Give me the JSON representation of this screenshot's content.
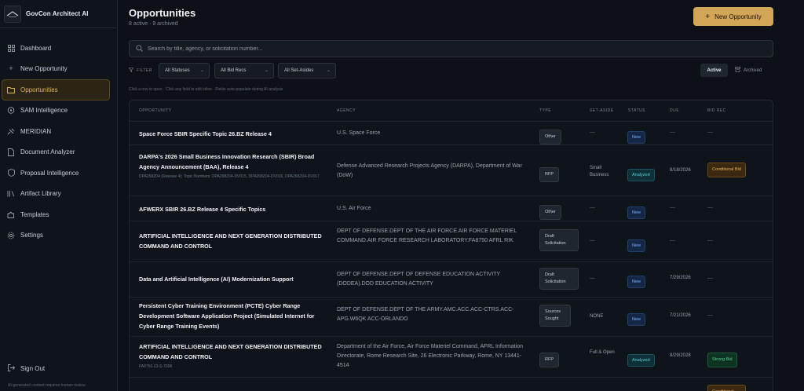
{
  "app": {
    "title": "GovCon Architect AI"
  },
  "sidebar": {
    "items": [
      {
        "label": "Dashboard",
        "icon": "grid-icon"
      },
      {
        "label": "New Opportunity",
        "icon": "plus-icon"
      },
      {
        "label": "Opportunities",
        "icon": "folder-icon",
        "active": true
      },
      {
        "label": "SAM Intelligence",
        "icon": "radar-icon"
      },
      {
        "label": "MERIDIAN",
        "icon": "satellite-icon"
      },
      {
        "label": "Document Analyzer",
        "icon": "document-icon"
      },
      {
        "label": "Proposal Intelligence",
        "icon": "shield-icon"
      },
      {
        "label": "Artifact Library",
        "icon": "library-icon"
      },
      {
        "label": "Templates",
        "icon": "puzzle-icon"
      },
      {
        "label": "Settings",
        "icon": "gear-icon"
      }
    ],
    "signout": "Sign Out",
    "disclaimer": "AI-generated content requires human review"
  },
  "header": {
    "title": "Opportunities",
    "subtitle": "8 active · 9 archived",
    "new_button": "New Opportunity"
  },
  "search": {
    "placeholder": "Search by title, agency, or solicitation number..."
  },
  "filters": {
    "label": "FILTER",
    "statuses": "All Statuses",
    "bid_recs": "All Bid Recs",
    "set_asides": "All Set-Asides",
    "active_toggle": "Active",
    "archived_toggle": "Archived"
  },
  "hint": "Click a row to open · Click any field to edit inline · Fields auto-populate during AI analysis",
  "table": {
    "headers": {
      "opportunity": "OPPORTUNITY",
      "agency": "AGENCY",
      "type": "TYPE",
      "set_aside": "SET-ASIDE",
      "status": "STATUS",
      "due": "DUE",
      "bid_rec": "BID REC"
    },
    "rows": [
      {
        "title": "Space Force SBIR Specific Topic 26.BZ Release 4",
        "sub": "",
        "agency": "U.S. Space Force",
        "type": "Other",
        "set_aside": "—",
        "status": "New",
        "due": "—",
        "bid_rec": "—"
      },
      {
        "title": "DARPA's 2026 Small Business Innovation Research (SBIR) Broad Agency Announcement (BAA), Release 4",
        "sub": "DPA268Z04 (Release 4); Topic Numbers: DPA268Z04-DV015, DPA268Z04-DV016, DPA268Z04-DV017",
        "agency": "Defense Advanced Research Projects Agency (DARPA), Department of War (DoW)",
        "type": "RFP",
        "set_aside": "Small Business",
        "status": "Analyzed",
        "due": "8/18/2026",
        "bid_rec": "Conditional Bid"
      },
      {
        "title": "AFWERX SBIR 26.BZ Release 4 Specific Topics",
        "sub": "",
        "agency": "U.S. Air Force",
        "type": "Other",
        "set_aside": "—",
        "status": "New",
        "due": "—",
        "bid_rec": "—"
      },
      {
        "title": "ARTIFICIAL INTELLIGENCE AND NEXT GENERATION DISTRIBUTED COMMAND AND CONTROL",
        "sub": "",
        "agency": "DEPT OF DEFENSE.DEPT OF THE AIR FORCE.AIR FORCE MATERIEL COMMAND.AIR FORCE RESEARCH LABORATORY.FA8750 AFRL RIK",
        "type": "Draft Solicitation",
        "set_aside": "—",
        "status": "New",
        "due": "—",
        "bid_rec": "—"
      },
      {
        "title": "Data and Artificial Intelligence (AI) Modernization Support",
        "sub": "",
        "agency": "DEPT OF DEFENSE.DEPT OF DEFENSE EDUCATION ACTIVITY (DODEA).DOD EDUCATION ACTIVITY",
        "type": "Draft Solicitation",
        "set_aside": "—",
        "status": "New",
        "due": "7/29/2026",
        "bid_rec": "—"
      },
      {
        "title": "Persistent Cyber Training Environment (PCTE) Cyber Range Development Software Application Project (Simulated Internet for Cyber Range Training Events)",
        "sub": "",
        "agency": "DEPT OF DEFENSE.DEPT OF THE ARMY.AMC.ACC.ACC-CTRS.ACC-APG.W6QK ACC-ORLANDO",
        "type": "Sources Sought",
        "set_aside": "NONE",
        "status": "New",
        "due": "7/21/2026",
        "bid_rec": "—"
      },
      {
        "title": "ARTIFICIAL INTELLIGENCE AND NEXT GENERATION DISTRIBUTED COMMAND AND CONTROL",
        "sub": "FA8750-23-S-7006",
        "agency": "Department of the Air Force, Air Force Materiel Command, AFRL Information Directorate, Rome Research Site, 26 Electronic Parkway, Rome, NY 13441-4514",
        "type": "RFP",
        "set_aside": "Full & Open",
        "status": "Analyzed",
        "due": "8/29/2028",
        "bid_rec": "Strong Bid"
      },
      {
        "title": "",
        "sub": "",
        "agency": "",
        "type": "",
        "set_aside": "",
        "status": "",
        "due": "",
        "bid_rec": "Conditional"
      }
    ]
  },
  "colors": {
    "accent": "#d3a556",
    "background": "#0d1117",
    "status_new": "#7fb1ff",
    "status_analyzed": "#5bd0df",
    "bid_conditional": "#eab15a",
    "bid_strong": "#4fd18c"
  }
}
